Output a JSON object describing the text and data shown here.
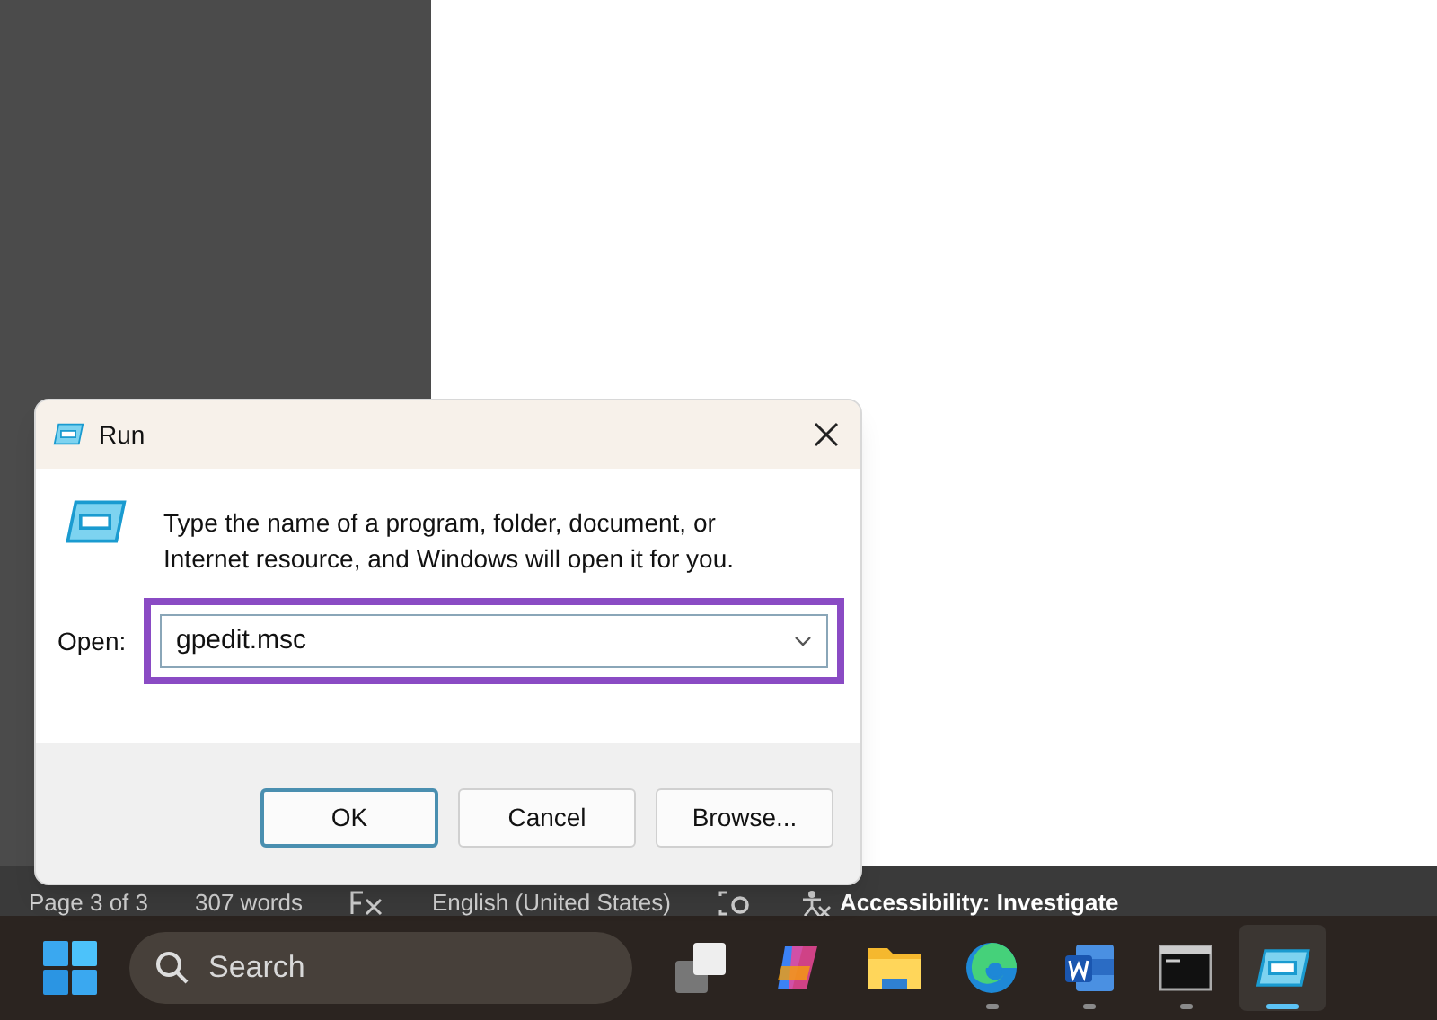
{
  "status_bar": {
    "items": [
      {
        "kind": "text",
        "text": "Page 3 of 3"
      },
      {
        "kind": "text",
        "text": "307 words"
      },
      {
        "kind": "proofing"
      },
      {
        "kind": "text",
        "text": "English (United States)"
      },
      {
        "kind": "focus"
      },
      {
        "kind": "accessibility",
        "text": "Accessibility: Investigate"
      }
    ]
  },
  "dialog": {
    "title": "Run",
    "description": "Type the name of a program, folder, document, or Internet resource, and Windows will open it for you.",
    "field_label": "Open:",
    "field_value": "gpedit.msc",
    "highlighted": true,
    "buttons": [
      {
        "label": "OK",
        "selected": true
      },
      {
        "label": "Cancel",
        "selected": false
      },
      {
        "label": "Browse...",
        "selected": false
      }
    ]
  },
  "taskbar": {
    "search": {
      "placeholder": "Search"
    },
    "apps": [
      {
        "kind": "taskview",
        "running": false,
        "selected": false
      },
      {
        "kind": "copilot",
        "running": false,
        "selected": false
      },
      {
        "kind": "folder",
        "running": false,
        "selected": false
      },
      {
        "kind": "edge",
        "running": true,
        "selected": false
      },
      {
        "kind": "word",
        "running": true,
        "selected": false
      },
      {
        "kind": "terminal",
        "running": true,
        "selected": false
      },
      {
        "kind": "run",
        "running": true,
        "selected": true
      }
    ]
  }
}
